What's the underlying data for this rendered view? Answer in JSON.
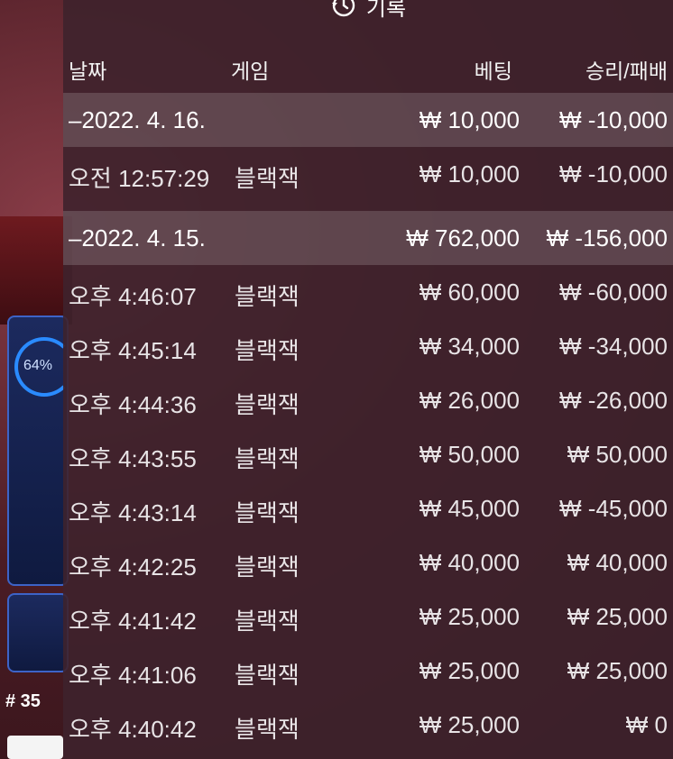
{
  "title": {
    "label": "기록"
  },
  "header": {
    "date": "날짜",
    "game": "게임",
    "bet": "베팅",
    "result": "승리/패배"
  },
  "background": {
    "progress_label": "64%",
    "round_label": "# 35"
  },
  "rows": [
    {
      "type": "date",
      "date": "–2022. 4. 16.",
      "game": "",
      "bet": "₩ 10,000",
      "result": "₩ -10,000"
    },
    {
      "type": "entry",
      "date": "오전 12:57:29",
      "game": "블랙잭",
      "bet": "₩ 10,000",
      "result": "₩ -10,000"
    },
    {
      "type": "date",
      "date": "–2022. 4. 15.",
      "game": "",
      "bet": "₩ 762,000",
      "result": "₩ -156,000"
    },
    {
      "type": "entry",
      "date": "오후 4:46:07",
      "game": "블랙잭",
      "bet": "₩ 60,000",
      "result": "₩ -60,000"
    },
    {
      "type": "entry",
      "date": "오후 4:45:14",
      "game": "블랙잭",
      "bet": "₩ 34,000",
      "result": "₩ -34,000"
    },
    {
      "type": "entry",
      "date": "오후 4:44:36",
      "game": "블랙잭",
      "bet": "₩ 26,000",
      "result": "₩ -26,000"
    },
    {
      "type": "entry",
      "date": "오후 4:43:55",
      "game": "블랙잭",
      "bet": "₩ 50,000",
      "result": "₩ 50,000"
    },
    {
      "type": "entry",
      "date": "오후 4:43:14",
      "game": "블랙잭",
      "bet": "₩ 45,000",
      "result": "₩ -45,000"
    },
    {
      "type": "entry",
      "date": "오후 4:42:25",
      "game": "블랙잭",
      "bet": "₩ 40,000",
      "result": "₩ 40,000"
    },
    {
      "type": "entry",
      "date": "오후 4:41:42",
      "game": "블랙잭",
      "bet": "₩ 25,000",
      "result": "₩ 25,000"
    },
    {
      "type": "entry",
      "date": "오후 4:41:06",
      "game": "블랙잭",
      "bet": "₩ 25,000",
      "result": "₩ 25,000"
    },
    {
      "type": "entry",
      "date": "오후 4:40:42",
      "game": "블랙잭",
      "bet": "₩ 25,000",
      "result": "₩ 0"
    }
  ]
}
